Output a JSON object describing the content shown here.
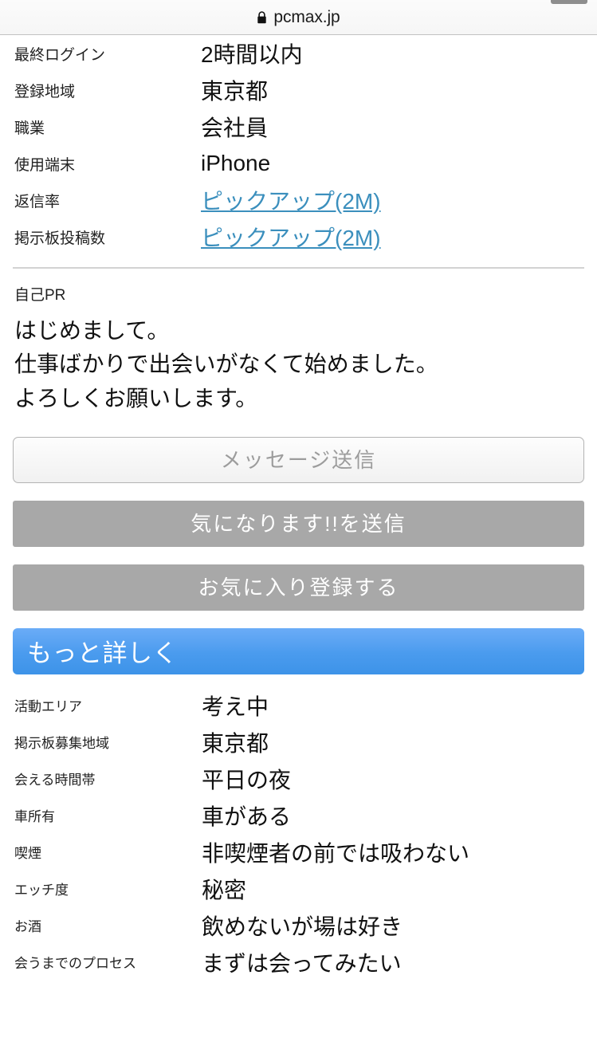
{
  "browser": {
    "url": "pcmax.jp",
    "lock_icon": "lock-icon"
  },
  "profile": {
    "rows": [
      {
        "label": "最終ログイン",
        "value": "2時間以内",
        "is_link": false
      },
      {
        "label": "登録地域",
        "value": "東京都",
        "is_link": false
      },
      {
        "label": "職業",
        "value": "会社員",
        "is_link": false
      },
      {
        "label": "使用端末",
        "value": "iPhone",
        "is_link": false
      },
      {
        "label": "返信率",
        "value": "ピックアップ(2M)",
        "is_link": true
      },
      {
        "label": "掲示板投稿数",
        "value": "ピックアップ(2M)",
        "is_link": true
      }
    ]
  },
  "self_pr": {
    "heading": "自己PR",
    "body": "はじめまして。\n仕事ばかりで出会いがなくて始めました。\nよろしくお願いします。"
  },
  "actions": {
    "message_label": "メッセージ送信",
    "interest_label": "気になります!!を送信",
    "favorite_label": "お気に入り登録する"
  },
  "more_section": {
    "title": "もっと詳しく",
    "rows": [
      {
        "label": "活動エリア",
        "value": "考え中"
      },
      {
        "label": "掲示板募集地域",
        "value": "東京都"
      },
      {
        "label": "会える時間帯",
        "value": "平日の夜"
      },
      {
        "label": "車所有",
        "value": "車がある"
      },
      {
        "label": "喫煙",
        "value": "非喫煙者の前では吸わない"
      },
      {
        "label": "エッチ度",
        "value": "秘密"
      },
      {
        "label": "お酒",
        "value": "飲めないが場は好き"
      },
      {
        "label": "会うまでのプロセス",
        "value": "まずは会ってみたい"
      }
    ]
  },
  "colors": {
    "link": "#3b8fbd",
    "section_header_top": "#6bacf7",
    "section_header_bottom": "#3d93e8",
    "grey_button": "#a8a8a8",
    "divider": "#d2d2d2"
  }
}
